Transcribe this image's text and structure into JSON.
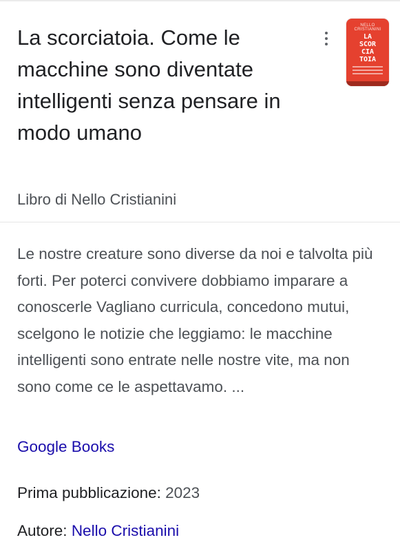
{
  "book": {
    "title": "La scorciatoia. Come le macchine sono diventate intelligenti senza pensare in modo umano",
    "subtitle": "Libro di Nello Cristianini",
    "more_options_icon": "more-vert-icon",
    "cover": {
      "author_text": "NELLO CRISTIANINI",
      "title_words": [
        "LA",
        "SCOR",
        "CIA",
        "TOIA"
      ],
      "background_color": "#e5412f"
    }
  },
  "description": {
    "text": "Le nostre creature sono diverse da noi e talvolta più forti. Per poterci convivere dobbiamo imparare a conoscerle Vagliano curricula, concedono mutui, scelgono le notizie che leggiamo: le macchine intelligenti sono entrate nelle nostre vite, ma non sono come ce le aspettavamo. ...",
    "source_label": "Google Books"
  },
  "facts": {
    "first_published_label": "Prima pubblicazione:",
    "first_published_value": "2023",
    "author_label": "Autore:",
    "author_value": "Nello Cristianini"
  },
  "colors": {
    "link": "#1a0dab",
    "title_text": "#202124",
    "secondary_text": "#4d5156"
  }
}
